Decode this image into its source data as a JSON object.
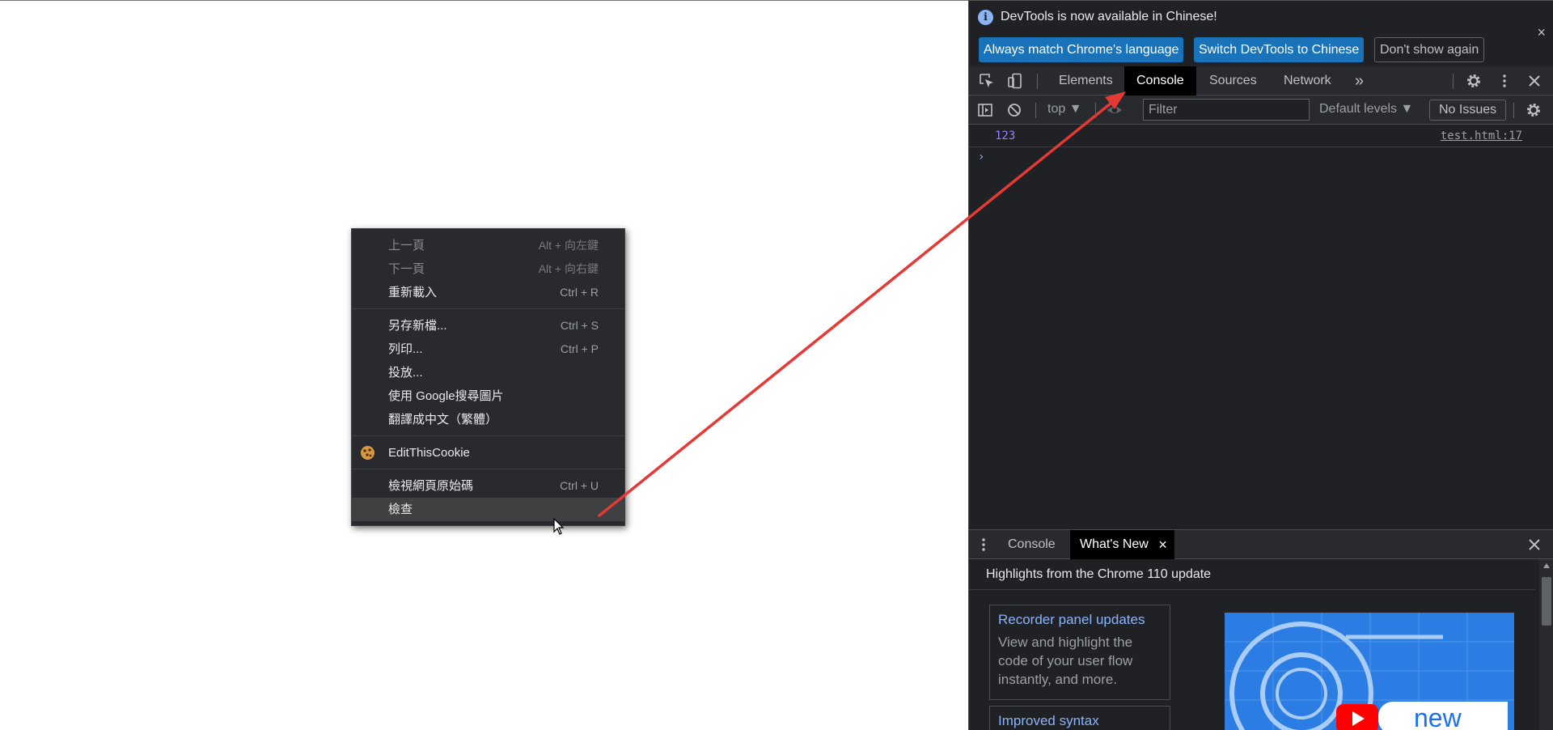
{
  "context_menu": {
    "items": [
      {
        "label": "上一頁",
        "shortcut": "Alt + 向左鍵",
        "disabled": true
      },
      {
        "label": "下一頁",
        "shortcut": "Alt + 向右鍵",
        "disabled": true
      },
      {
        "label": "重新載入",
        "shortcut": "Ctrl + R",
        "disabled": false
      },
      {
        "label": "另存新檔...",
        "shortcut": "Ctrl + S",
        "disabled": false
      },
      {
        "label": "列印...",
        "shortcut": "Ctrl + P",
        "disabled": false
      },
      {
        "label": "投放...",
        "shortcut": "",
        "disabled": false
      },
      {
        "label": "使用 Google搜尋圖片",
        "shortcut": "",
        "disabled": false
      },
      {
        "label": "翻譯成中文（繁體）",
        "shortcut": "",
        "disabled": false
      },
      {
        "label": "EditThisCookie",
        "shortcut": "",
        "disabled": false,
        "icon": "cookie-icon"
      },
      {
        "label": "檢視網頁原始碼",
        "shortcut": "Ctrl + U",
        "disabled": false
      },
      {
        "label": "檢查",
        "shortcut": "",
        "disabled": false,
        "highlighted": true
      }
    ]
  },
  "devtools": {
    "banner": {
      "message": "DevTools is now available in Chinese!",
      "btn_match": "Always match Chrome's language",
      "btn_switch": "Switch DevTools to Chinese",
      "btn_dismiss": "Don't show again",
      "close": "×"
    },
    "tabs": {
      "elements": "Elements",
      "console": "Console",
      "sources": "Sources",
      "network": "Network",
      "more": "»"
    },
    "toolbar": {
      "context": "top ▼",
      "filter_placeholder": "Filter",
      "levels": "Default levels ▼",
      "issues": "No Issues"
    },
    "console": {
      "log_value": "123",
      "log_source": "test.html:17",
      "prompt": "›"
    },
    "drawer": {
      "tab_console": "Console",
      "tab_whats_new": "What's New",
      "tab_close": "×",
      "close": "×",
      "heading": "Highlights from the Chrome 110 update",
      "cards": [
        {
          "title": "Recorder panel updates",
          "body": "View and highlight the code of your user flow instantly, and more."
        },
        {
          "title": "Improved syntax",
          "body": ""
        }
      ],
      "video_text": "new"
    }
  },
  "colors": {
    "accent_arrow": "#e53935",
    "primary_button": "#1a73b8",
    "console_number": "#9980ff",
    "link_blue": "#8ab4f8"
  }
}
